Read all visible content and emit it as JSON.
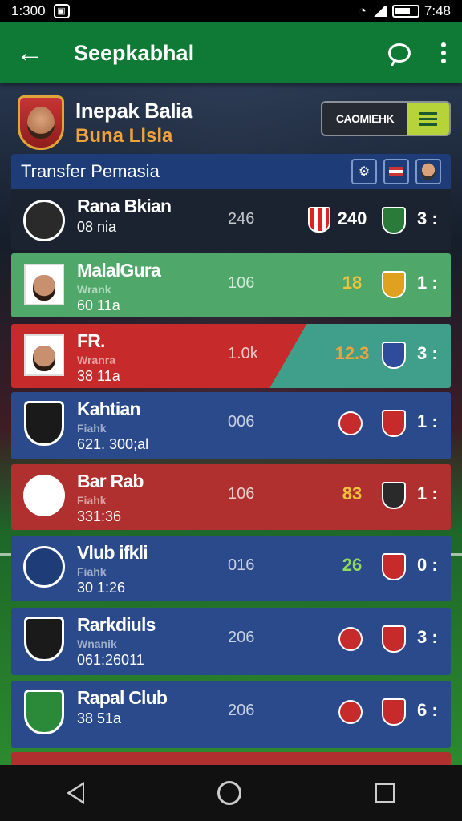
{
  "status_bar": {
    "time": "1:300",
    "right_time": "7:48"
  },
  "app_bar": {
    "title": "Seepkabhal"
  },
  "profile": {
    "name": "Inepak Balia",
    "club": "Buna Llsla",
    "compare_label": "CAOMIEHK"
  },
  "section": {
    "title": "Transfer Pemasia"
  },
  "rows": [
    {
      "name": "Rana Bkian",
      "sub": "",
      "value": "08 nia",
      "col1": "246",
      "col2": "240",
      "col2_color": "#ffffff",
      "rank": "3 :",
      "bg": "#1c2330",
      "avatar": "roundel",
      "avatar_color": "#2a2a2a",
      "crest_color": "#2a7a3a",
      "has_left_crest": true
    },
    {
      "name": "MalalGura",
      "sub": "Wrank",
      "value": "60 11a",
      "col1": "106",
      "col2": "18",
      "col2_color": "#f2c23a",
      "rank": "1 :",
      "bg": "#4fa86a",
      "avatar": "photo",
      "avatar_color": "#ffffff",
      "crest_color": "#e0a020",
      "has_left_crest": false
    },
    {
      "name": "FR.",
      "sub": "Wranra",
      "value": "38 11a",
      "col1": "1.0k",
      "col2": "12.3",
      "col2_color": "#f2a23a",
      "rank": "3 :",
      "bg": "#c62a2a",
      "avatar": "photo",
      "avatar_color": "#ffffff",
      "crest_color": "#2f4c9c",
      "has_left_crest": false
    },
    {
      "name": "Kahtian",
      "sub": "Fiahk",
      "value": "621. 300;al",
      "col1": "006",
      "col2": "",
      "col2_color": "#ffffff",
      "rank": "1 :",
      "bg": "#2a4a8c",
      "avatar": "shield",
      "avatar_color": "#1a1a1a",
      "crest_color": "#c62a2a",
      "has_left_crest": false
    },
    {
      "name": "Bar Rab",
      "sub": "Fiahk",
      "value": "331:36",
      "col1": "106",
      "col2": "83",
      "col2_color": "#f2c23a",
      "rank": "1 :",
      "bg": "#b03030",
      "avatar": "roundel",
      "avatar_color": "#ffffff",
      "crest_color": "#2a2a2a",
      "has_left_crest": false
    },
    {
      "name": "Vlub ifkli",
      "sub": "Fiahk",
      "value": "30 1:26",
      "col1": "016",
      "col2": "26",
      "col2_color": "#8fdc5a",
      "rank": "0 :",
      "bg": "#2a4a8c",
      "avatar": "roundel",
      "avatar_color": "#1e3c78",
      "crest_color": "#c62a2a",
      "has_left_crest": false
    },
    {
      "name": "Rarkdiuls",
      "sub": "Wnanik",
      "value": "061:26011",
      "col1": "206",
      "col2": "",
      "col2_color": "#ffffff",
      "rank": "3 :",
      "bg": "#2a4a8c",
      "avatar": "shield",
      "avatar_color": "#1a1a1a",
      "crest_color": "#c62a2a",
      "has_left_crest": false
    },
    {
      "name": "Rapal Club",
      "sub": "",
      "value": "38 51a",
      "col1": "206",
      "col2": "",
      "col2_color": "#ffffff",
      "rank": "6 :",
      "bg": "#2a4a8c",
      "avatar": "shield",
      "avatar_color": "#2a8a3a",
      "crest_color": "#c62a2a",
      "has_left_crest": false
    }
  ]
}
